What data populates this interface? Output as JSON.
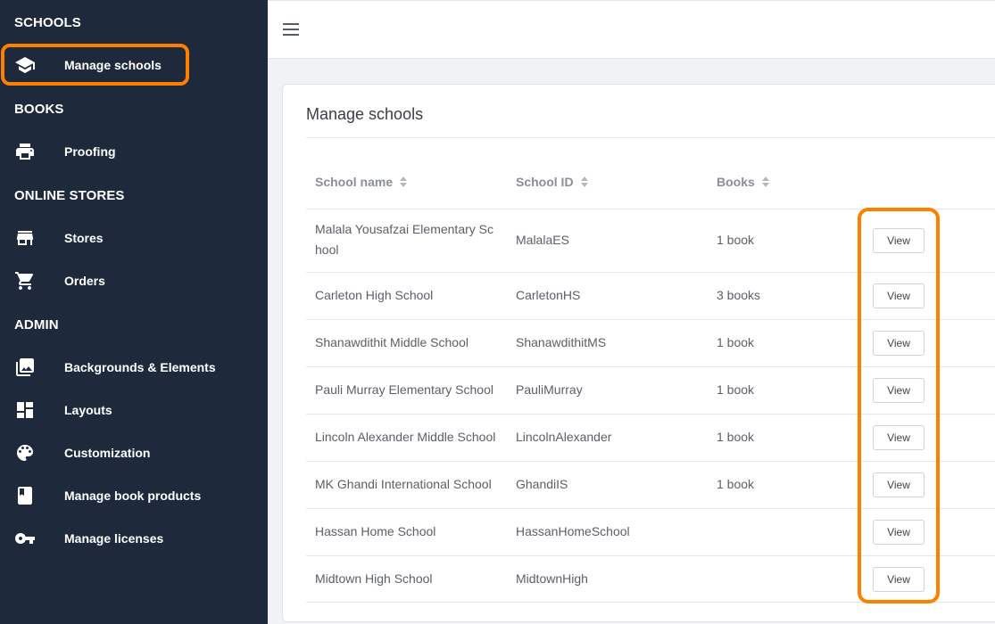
{
  "sidebar": {
    "sections": [
      {
        "title": "SCHOOLS"
      },
      {
        "title": "BOOKS"
      },
      {
        "title": "ONLINE STORES"
      },
      {
        "title": "ADMIN"
      }
    ],
    "items": [
      {
        "label": "Manage schools",
        "icon": "school-icon"
      },
      {
        "label": "Proofing",
        "icon": "printer-icon"
      },
      {
        "label": "Stores",
        "icon": "store-icon"
      },
      {
        "label": "Orders",
        "icon": "cart-icon"
      },
      {
        "label": "Backgrounds & Elements",
        "icon": "photo-library-icon"
      },
      {
        "label": "Layouts",
        "icon": "dashboard-icon"
      },
      {
        "label": "Customization",
        "icon": "palette-icon"
      },
      {
        "label": "Manage book products",
        "icon": "book-icon"
      },
      {
        "label": "Manage licenses",
        "icon": "key-icon"
      }
    ]
  },
  "main": {
    "title": "Manage schools",
    "columns": [
      "School name",
      "School ID",
      "Books"
    ],
    "view_label": "View",
    "rows": [
      {
        "name": "Malala Yousafzai Elementary Sc hool",
        "id": "MalalaES",
        "books": "1 book"
      },
      {
        "name": "Carleton High School",
        "id": "CarletonHS",
        "books": "3 books"
      },
      {
        "name": "Shanawdithit Middle School",
        "id": "ShanawdithitMS",
        "books": "1 book"
      },
      {
        "name": "Pauli Murray Elementary School",
        "id": "PauliMurray",
        "books": "1 book"
      },
      {
        "name": "Lincoln Alexander Middle School",
        "id": "LincolnAlexander",
        "books": "1 book"
      },
      {
        "name": "MK Ghandi International School",
        "id": "GhandiIS",
        "books": "1 book"
      },
      {
        "name": "Hassan Home School",
        "id": "HassanHomeSchool",
        "books": ""
      },
      {
        "name": "Midtown High School",
        "id": "MidtownHigh",
        "books": ""
      }
    ]
  },
  "colors": {
    "sidebar_bg": "#1e2a3c",
    "highlight": "#ff7f00",
    "page_bg": "#f0f2f5"
  }
}
